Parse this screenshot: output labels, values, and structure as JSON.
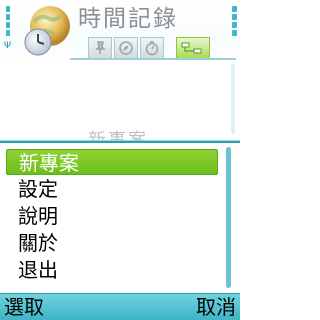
{
  "app": {
    "title": "時間記錄"
  },
  "background": {
    "text": "新事案"
  },
  "menu": {
    "items": [
      {
        "label": "新專案",
        "selected": true
      },
      {
        "label": "設定",
        "selected": false
      },
      {
        "label": "說明",
        "selected": false
      },
      {
        "label": "關於",
        "selected": false
      },
      {
        "label": "退出",
        "selected": false
      }
    ]
  },
  "tabs": [
    {
      "icon": "pin-icon",
      "active": false
    },
    {
      "icon": "compass-icon",
      "active": false
    },
    {
      "icon": "stopwatch-icon",
      "active": false
    },
    {
      "icon": "hierarchy-icon",
      "active": true
    }
  ],
  "softkeys": {
    "left": "選取",
    "right": "取消"
  },
  "colors": {
    "accent": "#3cb3c4",
    "highlight": "#7dc92a"
  }
}
